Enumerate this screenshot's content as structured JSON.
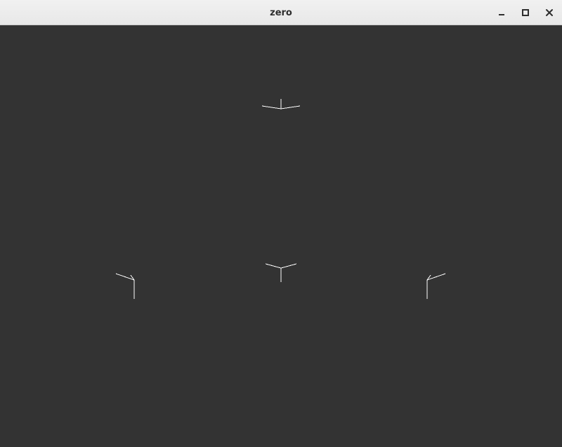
{
  "window": {
    "title": "zero"
  },
  "titlebar_buttons": [
    {
      "name": "minimize",
      "icon": "minimize-icon"
    },
    {
      "name": "maximize",
      "icon": "maximize-icon"
    },
    {
      "name": "close",
      "icon": "close-icon"
    }
  ],
  "colors": {
    "canvas_background": "#333333",
    "stroke": "#ffffff",
    "titlebar": "#eeeeee",
    "title_text": "#2e2e2e"
  }
}
